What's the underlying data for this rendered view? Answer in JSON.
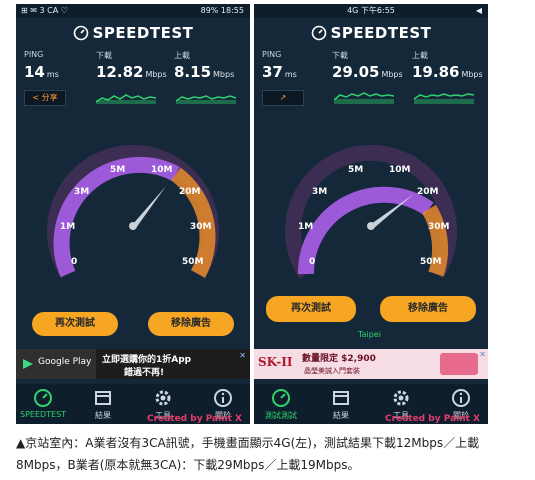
{
  "left": {
    "status": {
      "left": "⊞ ✉ 3 CA ♡",
      "right": "89% 18:55"
    },
    "brand": "SPEEDTEST",
    "ping": {
      "label": "PING",
      "value": "14",
      "unit": "ms"
    },
    "download": {
      "label": "下載",
      "value": "12.82",
      "unit": "Mbps"
    },
    "upload": {
      "label": "上載",
      "value": "8.15",
      "unit": "Mbps"
    },
    "share_label": "分享",
    "gauge_ticks": [
      "0",
      "1M",
      "3M",
      "5M",
      "10M",
      "20M",
      "30M",
      "50M"
    ],
    "btn_retest": "再次測試",
    "btn_remove_ads": "移除廣告",
    "ad": {
      "brand": "Google Play",
      "text1": "立即選購你的1折App",
      "text2": "錯過不再!"
    },
    "nav": [
      "SPEEDTEST",
      "結果",
      "工具",
      "關於"
    ],
    "watermark": "Created by Paint X"
  },
  "right": {
    "status": {
      "center": "4G 下午6:55",
      "right": "◀"
    },
    "brand": "SPEEDTEST",
    "ping": {
      "label": "PING",
      "value": "37",
      "unit": "ms"
    },
    "download": {
      "label": "下載",
      "value": "29.05",
      "unit": "Mbps"
    },
    "upload": {
      "label": "上載",
      "value": "19.86",
      "unit": "Mbps"
    },
    "gauge_ticks": [
      "0",
      "1M",
      "3M",
      "5M",
      "10M",
      "20M",
      "30M",
      "50M"
    ],
    "btn_retest": "再次測試",
    "btn_remove_ads": "移除廣告",
    "location": "Taipei",
    "ad": {
      "brand": "SK-II",
      "text1": "數量限定 $2,900",
      "text2": "晶瑩美誠入門套裝"
    },
    "nav": [
      "測試測試",
      "結果",
      "工具",
      "關於"
    ],
    "watermark": "Created by Paint X"
  },
  "caption": {
    "line1": "▲京站室內：A業者沒有3CA訊號，手機畫面顯示4G(左)，測試結果下載12Mbps／上載",
    "line2": "8Mbps，B業者(原本就無3CA)：下載29Mbps／上載19Mbps。"
  },
  "colors": {
    "bg": "#14283a",
    "accent": "#f6a623",
    "arc_purple": "#9d5ad8",
    "arc_orange": "#e88a2a"
  }
}
